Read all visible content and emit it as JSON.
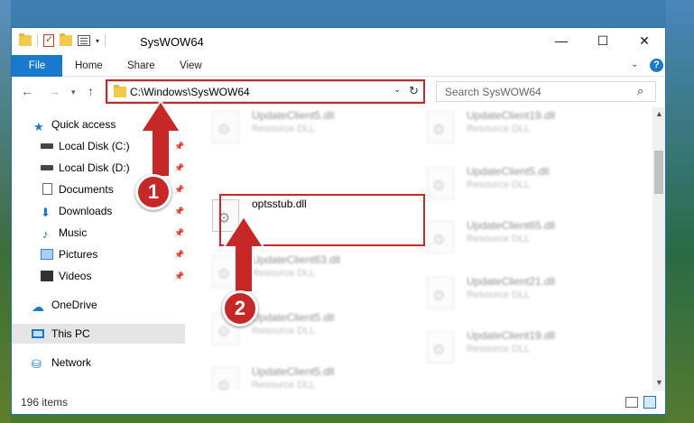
{
  "window": {
    "title": "SysWOW64",
    "controls": {
      "minimize": "—",
      "maximize": "☐",
      "close": "✕"
    }
  },
  "ribbon": {
    "tabs": [
      "File",
      "Home",
      "Share",
      "View"
    ],
    "help": "?"
  },
  "navigation": {
    "back": "←",
    "forward": "→",
    "recent": "▾",
    "up": "↑",
    "address": "C:\\Windows\\SysWOW64",
    "address_dropdown": "⌄",
    "refresh": "↻",
    "search_placeholder": "Search SysWOW64",
    "search_icon": "⌕"
  },
  "sidebar": {
    "items": [
      {
        "label": "Quick access",
        "icon": "star-icon",
        "glyph": "★",
        "pinned": false
      },
      {
        "label": "Local Disk (C:)",
        "icon": "drive-icon",
        "pinned": true
      },
      {
        "label": "Local Disk (D:)",
        "icon": "drive-icon",
        "pinned": true
      },
      {
        "label": "Documents",
        "icon": "documents-icon",
        "pinned": true
      },
      {
        "label": "Downloads",
        "icon": "downloads-icon",
        "glyph": "⬇",
        "pinned": true
      },
      {
        "label": "Music",
        "icon": "music-icon",
        "glyph": "♪",
        "pinned": true
      },
      {
        "label": "Pictures",
        "icon": "pictures-icon",
        "pinned": true
      },
      {
        "label": "Videos",
        "icon": "videos-icon",
        "pinned": true
      },
      {
        "label": "OneDrive",
        "icon": "cloud-icon",
        "glyph": "☁",
        "pinned": false
      },
      {
        "label": "This PC",
        "icon": "computer-icon",
        "pinned": false,
        "selected": true
      },
      {
        "label": "Network",
        "icon": "network-icon",
        "glyph": "⛁",
        "pinned": false
      }
    ],
    "pin_glyph": "📌"
  },
  "files": {
    "left_column": [
      {
        "name": "UpdateClient5.dll",
        "type": "Resource DLL",
        "blurred": true
      },
      {
        "name": "optsstub.dll",
        "type": "",
        "blurred": false,
        "highlighted": true
      },
      {
        "name": "UpdateClient63.dll",
        "type": "Resource DLL",
        "blurred": true
      },
      {
        "name": "UpdateClient5.dll",
        "type": "Resource DLL",
        "blurred": true
      },
      {
        "name": "UpdateClient5.dll",
        "type": "Resource DLL",
        "blurred": true
      }
    ],
    "right_column": [
      {
        "name": "UpdateClient19.dll",
        "type": "Resource DLL",
        "blurred": true
      },
      {
        "name": "UpdateClient5.dll",
        "type": "Resource DLL",
        "blurred": true
      },
      {
        "name": "UpdateClient65.dll",
        "type": "Resource DLL",
        "blurred": true
      },
      {
        "name": "UpdateClient21.dll",
        "type": "Resource DLL",
        "blurred": true
      },
      {
        "name": "UpdateClient19.dll",
        "type": "Resource DLL",
        "blurred": true
      }
    ],
    "gear_glyph": "⚙"
  },
  "status": {
    "item_count": "196 items"
  },
  "annotations": {
    "step1": "1",
    "step2": "2",
    "highlight_color": "#c62828"
  },
  "colors": {
    "accent": "#1979ca",
    "highlight": "#c62828"
  }
}
